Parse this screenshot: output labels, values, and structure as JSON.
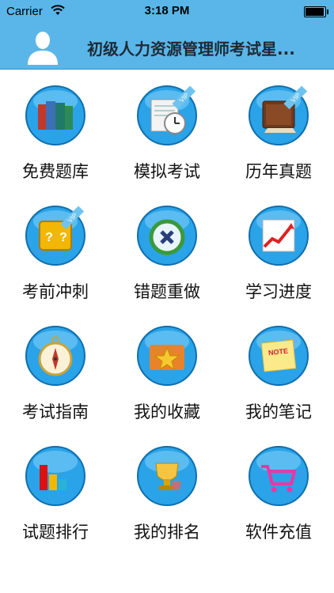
{
  "status": {
    "carrier": "Carrier",
    "time": "3:18 PM",
    "battery_level": 0.9
  },
  "header": {
    "title": "初级人力资源管理师考试星...",
    "avatar_icon": "user-avatar-icon"
  },
  "menu": [
    {
      "label": "免费题库",
      "icon": "books-icon"
    },
    {
      "label": "模拟考试",
      "icon": "exam-clock-icon",
      "vip": "VIP"
    },
    {
      "label": "历年真题",
      "icon": "old-book-icon",
      "vip": "VIP"
    },
    {
      "label": "考前冲刺",
      "icon": "question-box-icon",
      "vip": "VIP"
    },
    {
      "label": "错题重做",
      "icon": "redo-icon"
    },
    {
      "label": "学习进度",
      "icon": "progress-chart-icon"
    },
    {
      "label": "考试指南",
      "icon": "compass-icon"
    },
    {
      "label": "我的收藏",
      "icon": "star-folder-icon"
    },
    {
      "label": "我的笔记",
      "icon": "note-icon",
      "note_text": "NOTE"
    },
    {
      "label": "试题排行",
      "icon": "bar-chart-icon"
    },
    {
      "label": "我的排名",
      "icon": "trophy-icon"
    },
    {
      "label": "软件充值",
      "icon": "cart-icon"
    }
  ]
}
